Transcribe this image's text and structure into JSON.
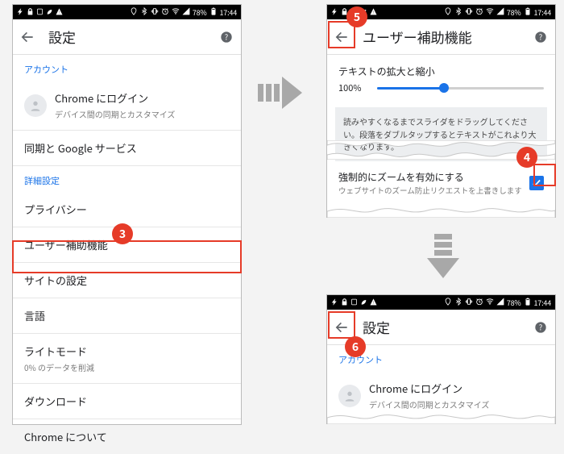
{
  "statusbar": {
    "battery_text": "78%",
    "time": "17:44"
  },
  "annotations": {
    "n3": "3",
    "n4": "4",
    "n5": "5",
    "n6": "6"
  },
  "settings": {
    "title": "設定",
    "sec_account": "アカウント",
    "signin_title": "Chrome にログイン",
    "signin_sub": "デバイス間の同期とカスタマイズ",
    "row_sync": "同期と Google サービス",
    "sec_advanced": "詳細設定",
    "row_privacy": "プライバシー",
    "row_accessibility": "ユーザー補助機能",
    "row_site": "サイトの設定",
    "row_lang": "言語",
    "row_lite_title": "ライトモード",
    "row_lite_sub": "0% のデータを削減",
    "row_downloads": "ダウンロード",
    "row_about": "Chrome について"
  },
  "accessibility": {
    "title": "ユーザー補助機能",
    "text_scaling_header": "テキストの拡大と縮小",
    "scale_pct": "100%",
    "info_text": "読みやすくなるまでスライダをドラッグしてください。段落をダブルタップするとテキストがこれより大きくなります。",
    "force_zoom_title": "強制的にズームを有効にする",
    "force_zoom_sub": "ウェブサイトのズーム防止リクエストを上書きします"
  }
}
